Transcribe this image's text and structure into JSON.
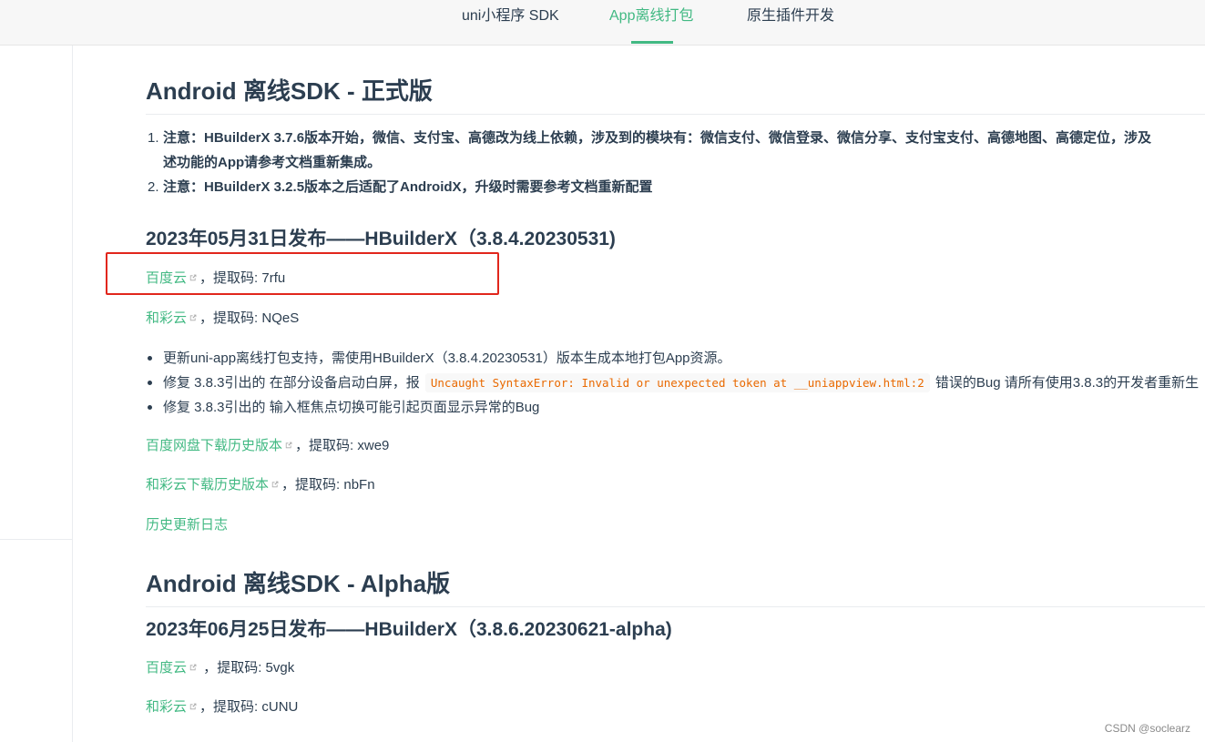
{
  "nav": {
    "items": [
      {
        "label": "uni小程序 SDK",
        "active": false
      },
      {
        "label": "App离线打包",
        "active": true
      },
      {
        "label": "原生插件开发",
        "active": false
      }
    ]
  },
  "section1": {
    "title": "Android 离线SDK - 正式版",
    "notes": [
      {
        "num": "1.",
        "line1": "注意：HBuilderX 3.7.6版本开始，微信、支付宝、高德改为线上依赖，涉及到的模块有：微信支付、微信登录、微信分享、支付宝支付、高德地图、高德定位，涉及",
        "line2": "述功能的App请参考文档重新集成。"
      },
      {
        "num": "2.",
        "line1": "注意：HBuilderX 3.2.5版本之后适配了AndroidX，升级时需要参考文档重新配置"
      }
    ],
    "release": {
      "title": "2023年05月31日发布——HBuilderX（3.8.4.20230531)",
      "baidu": {
        "link": "百度云",
        "sep": "，",
        "code_label": "提取码: 7rfu"
      },
      "hecai": {
        "link": "和彩云",
        "sep": "，",
        "code_label": "提取码: NQeS"
      },
      "changes": [
        {
          "text": "更新uni-app离线打包支持，需使用HBuilderX（3.8.4.20230531）版本生成本地打包App资源。"
        },
        {
          "pre": "修复 3.8.3引出的 在部分设备启动白屏，报 ",
          "code": "Uncaught SyntaxError: Invalid or unexpected token at __uniappview.html:2",
          "post": " 错误的Bug 请所有使用3.8.3的开发者重新生"
        },
        {
          "text": "修复 3.8.3引出的 输入框焦点切换可能引起页面显示异常的Bug"
        }
      ],
      "history_baidu": {
        "link": "百度网盘下载历史版本",
        "sep": "，",
        "code_label": "提取码: xwe9"
      },
      "history_hecai": {
        "link": "和彩云下载历史版本",
        "sep": "，",
        "code_label": "提取码: nbFn"
      },
      "changelog": "历史更新日志"
    }
  },
  "section2": {
    "title": "Android 离线SDK - Alpha版",
    "release": {
      "title": "2023年06月25日发布——HBuilderX（3.8.6.20230621-alpha)",
      "baidu": {
        "link": "百度云",
        "sep": " ，",
        "code_label": "提取码: 5vgk"
      },
      "hecai": {
        "link": "和彩云",
        "sep": "，",
        "code_label": "提取码: cUNU"
      }
    }
  },
  "watermark": "CSDN @soclearz",
  "colors": {
    "accent": "#42b983",
    "text": "#2c3e50",
    "code": "#e96900",
    "annotation": "#e1261c"
  }
}
